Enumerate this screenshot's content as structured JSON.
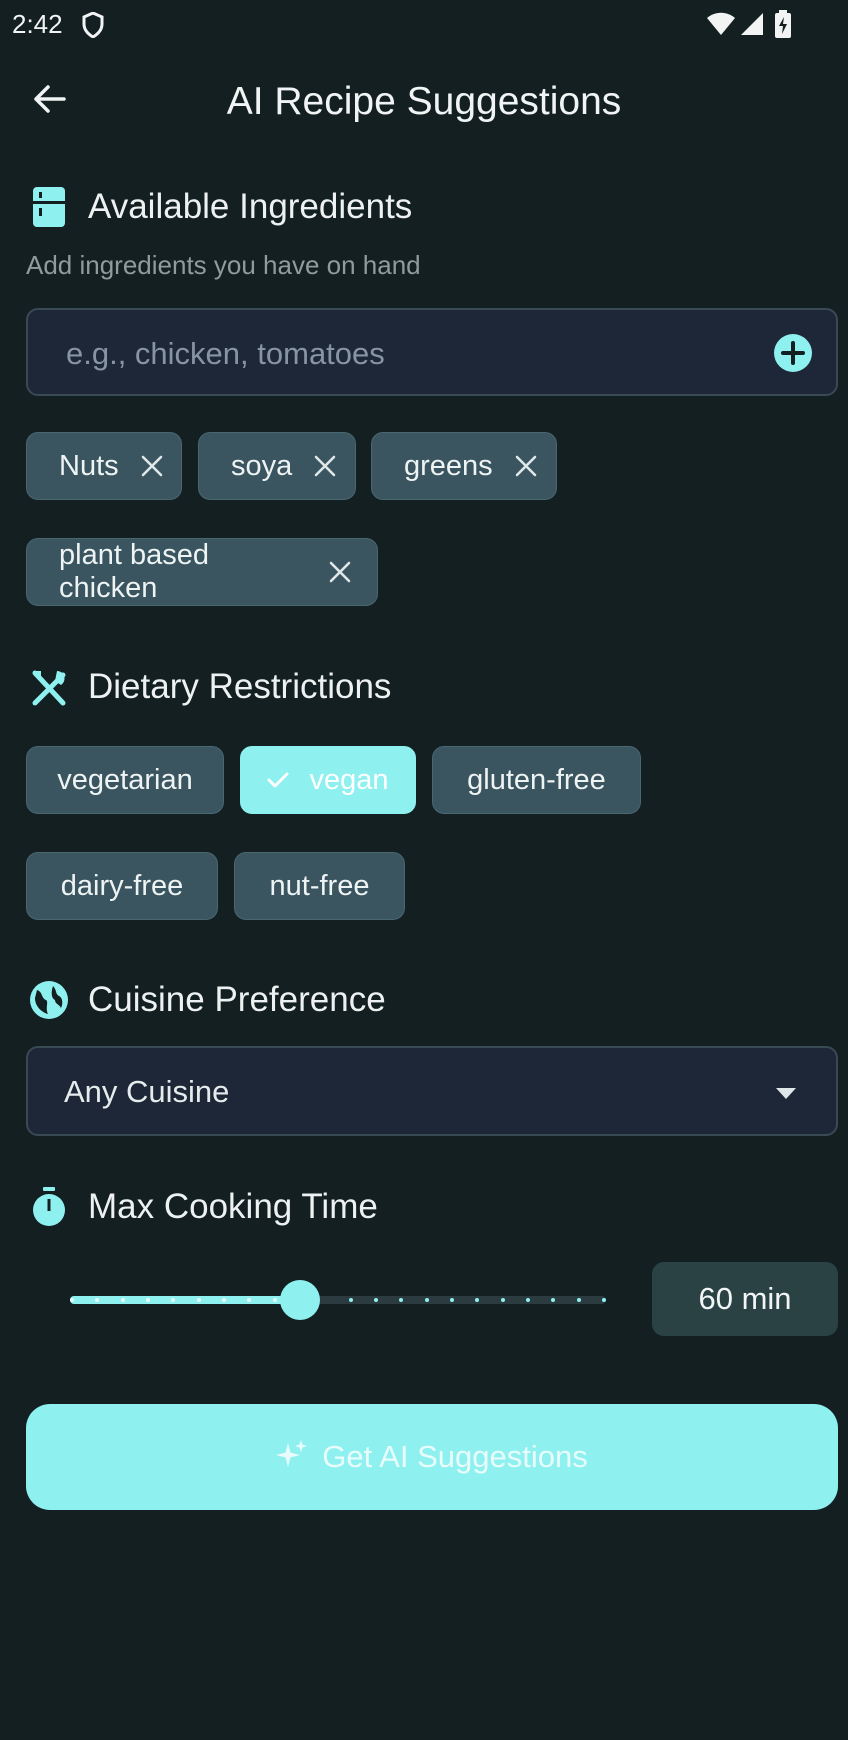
{
  "status_bar": {
    "time": "2:42",
    "icons": [
      "shield-icon",
      "wifi-icon",
      "signal-icon",
      "battery-charging-icon"
    ]
  },
  "header": {
    "title": "AI Recipe Suggestions",
    "back_icon": "arrow-back-icon"
  },
  "ingredients": {
    "title": "Available Ingredients",
    "icon": "fridge-icon",
    "helper": "Add ingredients you have on hand",
    "input_placeholder": "e.g., chicken, tomatoes",
    "input_value": "",
    "add_icon": "add-circle-icon",
    "chips": [
      "Nuts",
      "soya",
      "greens",
      "plant based chicken"
    ]
  },
  "dietary": {
    "title": "Dietary Restrictions",
    "icon": "fork-knife-icon",
    "options": [
      {
        "label": "vegetarian",
        "selected": false
      },
      {
        "label": "vegan",
        "selected": true
      },
      {
        "label": "gluten-free",
        "selected": false
      },
      {
        "label": "dairy-free",
        "selected": false
      },
      {
        "label": "nut-free",
        "selected": false
      }
    ]
  },
  "cuisine": {
    "title": "Cuisine Preference",
    "icon": "globe-icon",
    "selected": "Any Cuisine"
  },
  "cooking_time": {
    "title": "Max Cooking Time",
    "icon": "timer-icon",
    "value_label": "60 min",
    "slider_fraction": 0.43
  },
  "action": {
    "label": "Get AI Suggestions",
    "icon": "sparkle-icon"
  },
  "colors": {
    "background": "#131f20",
    "accent": "#8ff0f0",
    "chip": "#3a5560",
    "field": "#1d2737"
  }
}
